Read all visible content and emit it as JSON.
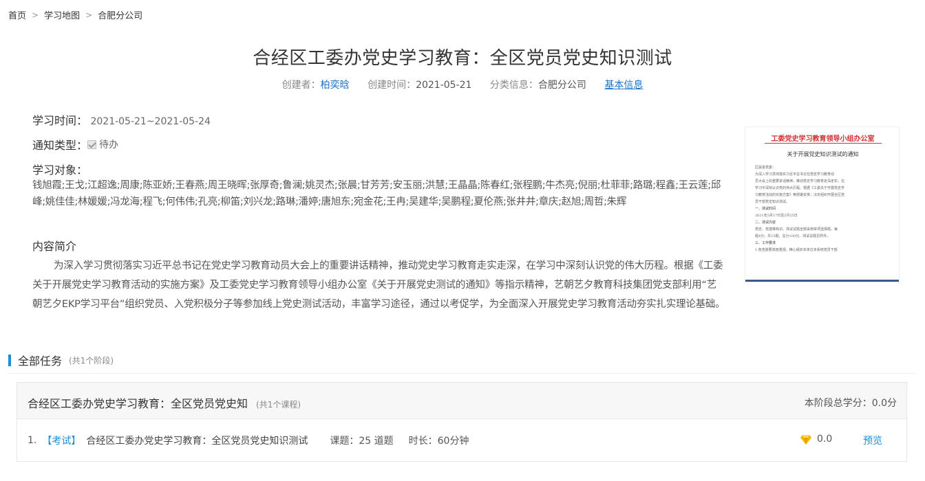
{
  "breadcrumb": [
    "首页",
    "学习地图",
    "合肥分公司"
  ],
  "title": "合经区工委办党史学习教育：全区党员党史知识测试",
  "meta": {
    "creator_label": "创建者：",
    "creator": "柏奕晗",
    "time_label": "创建时间：",
    "time": "2021-05-21",
    "category_label": "分类信息：",
    "category": "合肥分公司",
    "basic_info": "基本信息"
  },
  "study_time": {
    "label": "学习时间：",
    "value": "2021-05-21~2021-05-24"
  },
  "notice_type": {
    "label": "通知类型：",
    "value": "待办"
  },
  "study_target": {
    "label": "学习对象：",
    "value": "钱旭霞;王戈;江超逸;周康;陈亚娇;王春燕;周王晓晖;张厚奇;鲁澜;姚灵杰;张晨;甘芳芳;安玉丽;洪慧;王晶晶;陈春红;张程鹏;牛杰亮;倪丽;杜菲菲;路璐;程鑫;王云莲;邱峰;姚佳佳;林媛媛;冯龙海;程飞;何伟伟;孔亮;柳笛;刘兴龙;路琳;潘婷;唐旭东;宛金花;王冉;吴建华;吴鹏程;夏伦燕;张井井;章庆;赵旭;周哲;朱辉"
  },
  "intro": {
    "label": "内容简介",
    "text": "为深入学习贯彻落实习近平总书记在党史学习教育动员大会上的重要讲话精神，推动党史学习教育走实走深，在学习中深刻认识党的伟大历程。根据《工委关于开展党史学习教育活动的实施方案》及工委党史学习教育领导小组办公室《关于开展党史测试的通知》等指示精神，艺朝艺夕教育科技集团党支部利用“艺朝艺夕EKP学习平台”组织党员、入党积极分子等参加线上党史测试活动，丰富学习途径，通过以考促学，为全面深入开展党史学习教育活动夯实扎实理论基础。"
  },
  "doc": {
    "header": "工委党史学习教育领导小组办公室",
    "subtitle": "关于开展党史知识测试的通知",
    "lines": [
      "区属各党委：",
      "为深入学习贯彻落实习近平总书记在党史学习教育动",
      "员大会上的重要讲话精神，推动党史学习教育走深走实，在",
      "学习中深刻认识党的伟大历程。根据《工委关于开展党史学",
      "习教育活动的实施方案》等部署安排，决定组织开展全区党",
      "员干部党史知识测试。",
      "一、测试时间",
      "2021年5月17日至5月25日",
      "二、测试内容",
      "党史、党建等知识。测试试题全部采用单项选择题，每",
      "题4分，共25题，总分100分。测试试题见附件。",
      "三、工作要求",
      "1.各党委要高度重视，精心组织本单位本系统党员干部"
    ]
  },
  "tasks": {
    "title": "全部任务",
    "count": "(共1个阶段)",
    "stage": {
      "title": "合经区工委办党史学习教育：全区党员党史知",
      "count": "(共1个课程)",
      "score": "本阶段总学分：0.0分",
      "item": {
        "num": "1.",
        "tag": "【考试】",
        "name": "合经区工委办党史学习教育：全区党员党史知识测试",
        "questions": "课题：25 道题",
        "duration": "时长：60分钟",
        "score": "0.0",
        "action": "预览"
      }
    }
  },
  "colors": {
    "accent": "#1a8fd9",
    "link": "#1a73c9",
    "doc_red": "#d23232",
    "gem": "#f5b800"
  }
}
